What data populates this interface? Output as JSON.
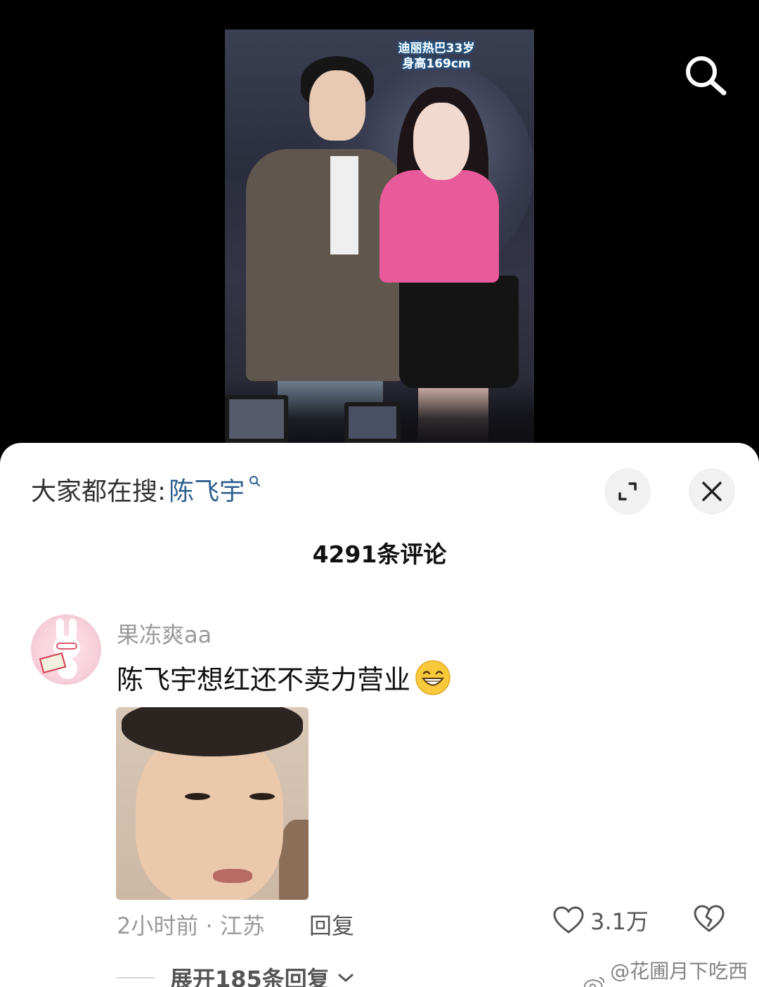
{
  "video": {
    "caption_line1": "迪丽热巴33岁",
    "caption_line2": "身高169cm"
  },
  "top_bar": {
    "search_icon": "search-icon"
  },
  "sheet": {
    "hot_search_prefix": "大家都在搜:",
    "hot_search_term": "陈飞宇",
    "expand_icon": "expand-icon",
    "close_icon": "close-icon",
    "comment_count": "4291条评论"
  },
  "comment": {
    "username": "果冻爽aa",
    "text": "陈飞宇想红还不卖力营业",
    "emoji": "grinning-face-emoji",
    "meta": "2小时前 · 江苏",
    "reply_label": "回复",
    "like_count": "3.1万",
    "expand_replies_label": "展开185条回复"
  },
  "watermark": {
    "text": "@花圃月下吃西瓜"
  },
  "colors": {
    "link_blue": "#2f5f8f",
    "muted_gray": "#9a9a9a",
    "sheet_bg": "#ffffff",
    "page_bg": "#000000"
  }
}
